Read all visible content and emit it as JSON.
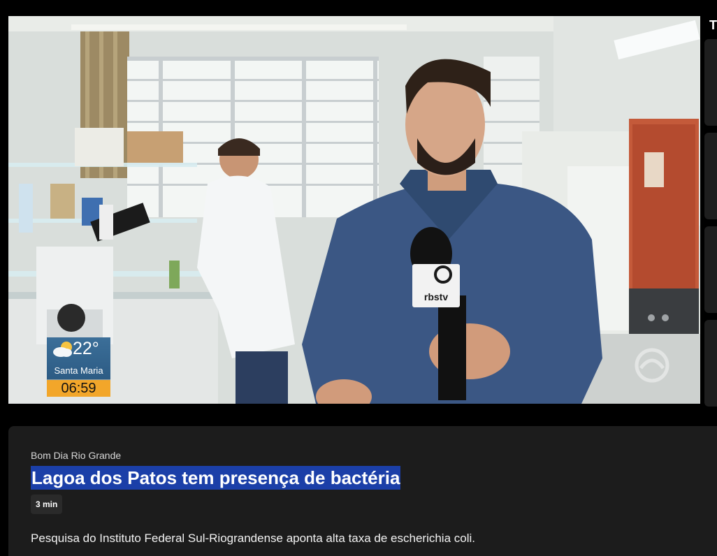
{
  "video": {
    "weather": {
      "temperature": "22°",
      "city": "Santa Maria",
      "time": "06:59",
      "icon": "partly-cloudy-icon"
    },
    "mic_flag": "rbstv",
    "watermark": "rbs-logo-icon"
  },
  "rail": {
    "title_letter": "T"
  },
  "info": {
    "program": "Bom Dia Rio Grande",
    "title": "Lagoa dos Patos tem presença de bactéria",
    "duration": "3 min",
    "description": "Pesquisa do Instituto Federal Sul-Riograndense aponta alta taxa de escherichia coli."
  },
  "colors": {
    "background": "#000000",
    "panel": "#1c1c1c",
    "title_highlight": "#1b3fa8",
    "clock_badge": "#f2a62a",
    "weather_box": "#2c5b84"
  }
}
